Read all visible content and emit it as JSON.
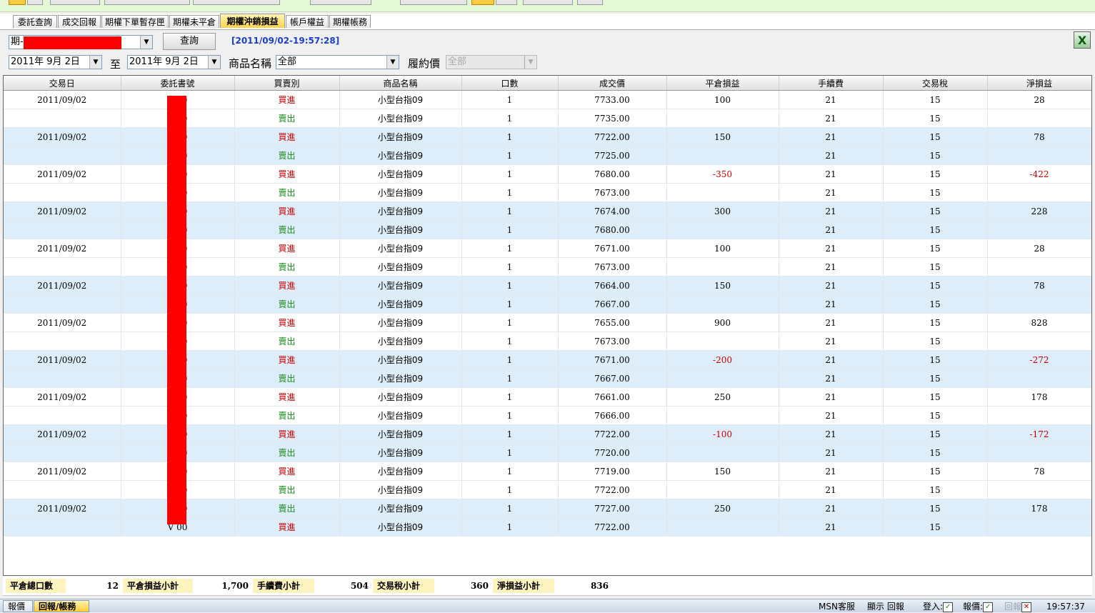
{
  "tabs": [
    "委託查詢",
    "成交回報",
    "期權下單暫存匣",
    "期權未平倉",
    "期權沖銷損益",
    "帳戶權益",
    "期權帳務"
  ],
  "active_tab": 4,
  "filter": {
    "account_prefix": "期-",
    "query_button": "查詢",
    "timestamp": "[2011/09/02-19:57:28]",
    "date_from": "2011年  9月  2日",
    "to_label": "至",
    "date_to": "2011年  9月  2日",
    "product_label": "商品名稱",
    "product_value": "全部",
    "strike_label": "履約價",
    "strike_value": "全部"
  },
  "columns": [
    "交易日",
    "委託書號",
    "買賣別",
    "商品名稱",
    "口數",
    "成交價",
    "平倉損益",
    "手續費",
    "交易稅",
    "淨損益"
  ],
  "rows": [
    {
      "date": "2011/09/02",
      "order": "V      00",
      "side": "買進",
      "product": "小型台指09",
      "qty": "1",
      "price": "7733.00",
      "pnl": "100",
      "fee": "21",
      "tax": "15",
      "net": "28"
    },
    {
      "date": "",
      "order": "V      00",
      "side": "賣出",
      "product": "小型台指09",
      "qty": "1",
      "price": "7735.00",
      "pnl": "",
      "fee": "21",
      "tax": "15",
      "net": ""
    },
    {
      "date": "2011/09/02",
      "order": "V      00",
      "side": "買進",
      "product": "小型台指09",
      "qty": "1",
      "price": "7722.00",
      "pnl": "150",
      "fee": "21",
      "tax": "15",
      "net": "78"
    },
    {
      "date": "",
      "order": "V      00",
      "side": "賣出",
      "product": "小型台指09",
      "qty": "1",
      "price": "7725.00",
      "pnl": "",
      "fee": "21",
      "tax": "15",
      "net": ""
    },
    {
      "date": "2011/09/02",
      "order": "V      00",
      "side": "買進",
      "product": "小型台指09",
      "qty": "1",
      "price": "7680.00",
      "pnl": "-350",
      "fee": "21",
      "tax": "15",
      "net": "-422"
    },
    {
      "date": "",
      "order": "V      00",
      "side": "賣出",
      "product": "小型台指09",
      "qty": "1",
      "price": "7673.00",
      "pnl": "",
      "fee": "21",
      "tax": "15",
      "net": ""
    },
    {
      "date": "2011/09/02",
      "order": "V      00",
      "side": "買進",
      "product": "小型台指09",
      "qty": "1",
      "price": "7674.00",
      "pnl": "300",
      "fee": "21",
      "tax": "15",
      "net": "228"
    },
    {
      "date": "",
      "order": "V      00",
      "side": "賣出",
      "product": "小型台指09",
      "qty": "1",
      "price": "7680.00",
      "pnl": "",
      "fee": "21",
      "tax": "15",
      "net": ""
    },
    {
      "date": "2011/09/02",
      "order": "V      00",
      "side": "買進",
      "product": "小型台指09",
      "qty": "1",
      "price": "7671.00",
      "pnl": "100",
      "fee": "21",
      "tax": "15",
      "net": "28"
    },
    {
      "date": "",
      "order": "V      00",
      "side": "賣出",
      "product": "小型台指09",
      "qty": "1",
      "price": "7673.00",
      "pnl": "",
      "fee": "21",
      "tax": "15",
      "net": ""
    },
    {
      "date": "2011/09/02",
      "order": "V      00",
      "side": "買進",
      "product": "小型台指09",
      "qty": "1",
      "price": "7664.00",
      "pnl": "150",
      "fee": "21",
      "tax": "15",
      "net": "78"
    },
    {
      "date": "",
      "order": "V      00",
      "side": "賣出",
      "product": "小型台指09",
      "qty": "1",
      "price": "7667.00",
      "pnl": "",
      "fee": "21",
      "tax": "15",
      "net": ""
    },
    {
      "date": "2011/09/02",
      "order": "V      00",
      "side": "買進",
      "product": "小型台指09",
      "qty": "1",
      "price": "7655.00",
      "pnl": "900",
      "fee": "21",
      "tax": "15",
      "net": "828"
    },
    {
      "date": "",
      "order": "V      00",
      "side": "賣出",
      "product": "小型台指09",
      "qty": "1",
      "price": "7673.00",
      "pnl": "",
      "fee": "21",
      "tax": "15",
      "net": ""
    },
    {
      "date": "2011/09/02",
      "order": "V      00",
      "side": "買進",
      "product": "小型台指09",
      "qty": "1",
      "price": "7671.00",
      "pnl": "-200",
      "fee": "21",
      "tax": "15",
      "net": "-272"
    },
    {
      "date": "",
      "order": "V      00",
      "side": "賣出",
      "product": "小型台指09",
      "qty": "1",
      "price": "7667.00",
      "pnl": "",
      "fee": "21",
      "tax": "15",
      "net": ""
    },
    {
      "date": "2011/09/02",
      "order": "V      00",
      "side": "買進",
      "product": "小型台指09",
      "qty": "1",
      "price": "7661.00",
      "pnl": "250",
      "fee": "21",
      "tax": "15",
      "net": "178"
    },
    {
      "date": "",
      "order": "V      00",
      "side": "賣出",
      "product": "小型台指09",
      "qty": "1",
      "price": "7666.00",
      "pnl": "",
      "fee": "21",
      "tax": "15",
      "net": ""
    },
    {
      "date": "2011/09/02",
      "order": "V      00",
      "side": "買進",
      "product": "小型台指09",
      "qty": "1",
      "price": "7722.00",
      "pnl": "-100",
      "fee": "21",
      "tax": "15",
      "net": "-172"
    },
    {
      "date": "",
      "order": "V      00",
      "side": "賣出",
      "product": "小型台指09",
      "qty": "1",
      "price": "7720.00",
      "pnl": "",
      "fee": "21",
      "tax": "15",
      "net": ""
    },
    {
      "date": "2011/09/02",
      "order": "V      00",
      "side": "買進",
      "product": "小型台指09",
      "qty": "1",
      "price": "7719.00",
      "pnl": "150",
      "fee": "21",
      "tax": "15",
      "net": "78"
    },
    {
      "date": "",
      "order": "V      00",
      "side": "賣出",
      "product": "小型台指09",
      "qty": "1",
      "price": "7722.00",
      "pnl": "",
      "fee": "21",
      "tax": "15",
      "net": ""
    },
    {
      "date": "2011/09/02",
      "order": "V      00",
      "side": "賣出",
      "product": "小型台指09",
      "qty": "1",
      "price": "7727.00",
      "pnl": "250",
      "fee": "21",
      "tax": "15",
      "net": "178"
    },
    {
      "date": "",
      "order": "V      00",
      "side": "買進",
      "product": "小型台指09",
      "qty": "1",
      "price": "7722.00",
      "pnl": "",
      "fee": "21",
      "tax": "15",
      "net": ""
    }
  ],
  "summary": {
    "closed_lots_label": "平倉總口數",
    "closed_lots": "12",
    "pnl_label": "平倉損益小計",
    "pnl": "1,700",
    "fee_label": "手續費小計",
    "fee": "504",
    "tax_label": "交易稅小計",
    "tax": "360",
    "net_label": "淨損益小計",
    "net": "836"
  },
  "statusbar": {
    "tabs": [
      "報價",
      "回報/帳務"
    ],
    "active_tab": 1,
    "msn": "MSN客服",
    "show_report": "顯示 回報",
    "login": "登入:",
    "quote": "報價:",
    "report": "回報",
    "time": "19:57:37"
  },
  "colors": {
    "buy": "#cc0000",
    "sell": "#1a8a1a",
    "negative": "#cc0000",
    "active_tab": "#ffd34d",
    "row_alt": "#ddedf9"
  }
}
